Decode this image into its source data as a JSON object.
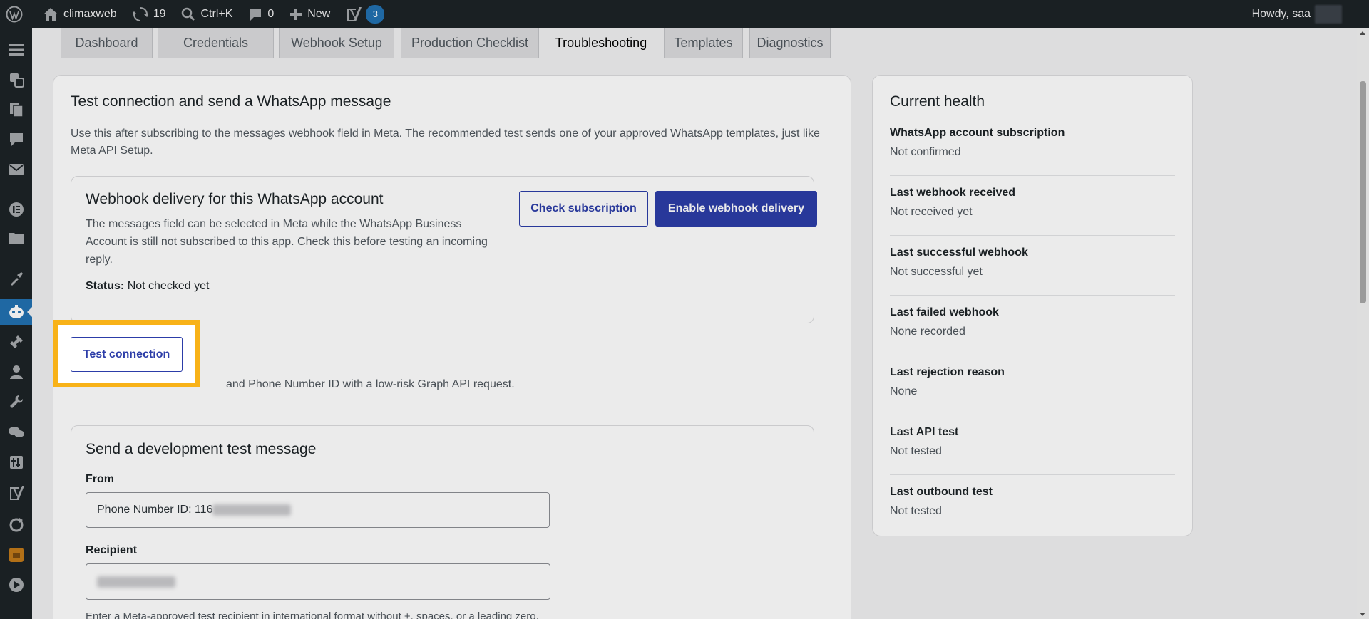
{
  "adminbar": {
    "site_name": "climaxweb",
    "updates_count": "19",
    "search_shortcut": "Ctrl+K",
    "comments_count": "0",
    "new_label": "New",
    "yoast_count": "3",
    "howdy": "Howdy, saa"
  },
  "tabs": [
    "Dashboard",
    "Credentials",
    "Webhook Setup",
    "Production Checklist",
    "Troubleshooting",
    "Templates",
    "Diagnostics"
  ],
  "active_tab": "Troubleshooting",
  "main": {
    "title": "Test connection and send a WhatsApp message",
    "intro_line1": "Use this after subscribing to the messages webhook field in Meta. The recommended test sends one of your approved WhatsApp templates, just like",
    "intro_line2": "Meta API Setup.",
    "webhook": {
      "title": "Webhook delivery for this WhatsApp account",
      "desc_line1": "The messages field can be selected in Meta while the WhatsApp Business",
      "desc_line2": "Account is still not subscribed to this app. Check this before testing an incoming",
      "desc_line3": "reply.",
      "status_label": "Status:",
      "status_value": "Not checked yet",
      "check_button": "Check subscription",
      "enable_button": "Enable webhook delivery"
    },
    "test_connection_button": "Test connection",
    "test_connection_hint": "Validates the saved token and Phone Number ID with a low-risk Graph API request.",
    "test_connection_hint_visible": "and Phone Number ID with a low-risk Graph API request.",
    "dev_message": {
      "title": "Send a development test message",
      "from_label": "From",
      "from_value": "Phone Number ID: 116",
      "recipient_label": "Recipient",
      "recipient_hint": "Enter a Meta-approved test recipient in international format without +, spaces, or a leading zero."
    }
  },
  "health": {
    "title": "Current health",
    "items": [
      {
        "label": "WhatsApp account subscription",
        "value": "Not confirmed"
      },
      {
        "label": "Last webhook received",
        "value": "Not received yet"
      },
      {
        "label": "Last successful webhook",
        "value": "Not successful yet"
      },
      {
        "label": "Last failed webhook",
        "value": "None recorded"
      },
      {
        "label": "Last rejection reason",
        "value": "None"
      },
      {
        "label": "Last API test",
        "value": "Not tested"
      },
      {
        "label": "Last outbound test",
        "value": "Not tested"
      }
    ]
  },
  "colors": {
    "primary": "#2c3da8",
    "highlight": "#f8b218",
    "adminbar": "#1d2327"
  }
}
